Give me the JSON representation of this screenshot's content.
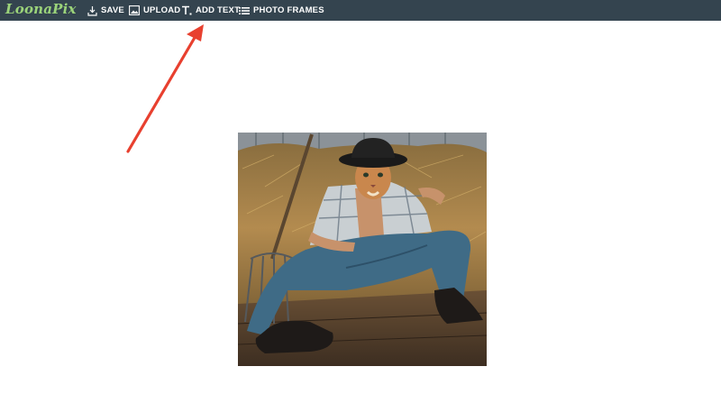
{
  "app": {
    "logo": "LoonaPix"
  },
  "toolbar": {
    "items": [
      {
        "label": "SAVE",
        "icon": "save-icon"
      },
      {
        "label": "UPLOAD",
        "icon": "image-icon"
      },
      {
        "label": "ADD TEXT",
        "icon": "text-icon"
      },
      {
        "label": "PHOTO FRAMES",
        "icon": "list-icon"
      }
    ]
  },
  "annotation": {
    "type": "arrow",
    "color": "#e8402f"
  },
  "canvas": {
    "content": "edited-photo"
  },
  "colors": {
    "toolbar_bg": "#34444f",
    "logo": "#9bd37a",
    "toolbar_text": "#ffffff"
  }
}
